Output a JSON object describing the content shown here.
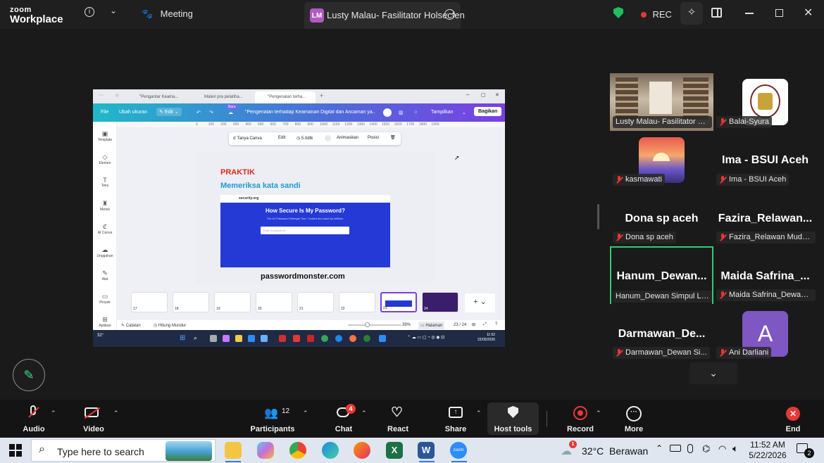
{
  "topbar": {
    "logo_line1": "zoom",
    "logo_line2": "Workplace",
    "meeting_label": "Meeting",
    "active_tab_avatar": "LM",
    "active_tab_title": "Lusty Malau- Fasilitator Holsecfen",
    "rec_label": "REC"
  },
  "shared_screen": {
    "browser_tabs": [
      "\"Pengantar Keama...",
      "Materi pra pelatiha...",
      "\"Pengenalan terha..."
    ],
    "canva": {
      "file": "File",
      "resize": "Ubah ukuran",
      "edit": "Edit",
      "new_badge": "Baru",
      "doc_title": "\"Pengenalan terhadap Keamanan Digital dan Ancaman ya...",
      "present": "Tampilkan",
      "share": "Bagikan",
      "sidebar": [
        "Template",
        "Elemen",
        "Teks",
        "Merek",
        "AI Canva",
        "Unggahan",
        "Alat",
        "Proyek",
        "Aplikasi"
      ],
      "floating_toolbar": [
        "Tanya Canva",
        "Edit",
        "5.0dtk",
        "Animasikan",
        "Posisi"
      ],
      "ruler_ticks": [
        "0",
        "100",
        "200",
        "300",
        "400",
        "500",
        "600",
        "700",
        "800",
        "900",
        "1000",
        "1100",
        "1200",
        "1300",
        "1400",
        "1500",
        "1600",
        "1700",
        "1800",
        "1900"
      ],
      "slide": {
        "kicker": "PRAKTIK",
        "title": "Memeriksa kata sandi",
        "site_brand": "security.org",
        "site_heading": "How Secure Is My Password?",
        "site_sub": "The #1 Password Strength Tool. Trusted and used by millions.",
        "site_placeholder": "Enter a password",
        "caption": "passwordmonster.com"
      },
      "thumb_numbers": [
        "17",
        "18",
        "19",
        "20",
        "21",
        "22",
        "23",
        "24"
      ],
      "notes": "Catatan",
      "timer": "Hitung Mundur",
      "zoom_pct": "39%",
      "page_label": "Halaman",
      "page_count": "23 / 24"
    },
    "win_time": "11:52",
    "win_date": "22/05/2026",
    "weather_temp": "32°"
  },
  "gallery": [
    {
      "name": "",
      "label": "Lusty Malau- Fasilitator H...",
      "muted": false,
      "kind": "photo-library"
    },
    {
      "name": "",
      "label": "Balai-Syura",
      "muted": true,
      "kind": "logo"
    },
    {
      "name": "",
      "label": "kasmawati",
      "muted": true,
      "kind": "sunset"
    },
    {
      "name": "Ima - BSUI Aceh",
      "label": "Ima - BSUI Aceh",
      "muted": true,
      "kind": "text"
    },
    {
      "name": "Dona sp aceh",
      "label": "Dona sp aceh",
      "muted": true,
      "kind": "text"
    },
    {
      "name": "Fazira_Relawan...",
      "label": "Fazira_Relawan Muda ...",
      "muted": true,
      "kind": "text"
    },
    {
      "name": "Hanum_Dewan...",
      "label": "Hanum_Dewan Simpul Lh...",
      "muted": false,
      "kind": "text",
      "active_speaker": true
    },
    {
      "name": "Maida Safrina_...",
      "label": "Maida Safrina_Dewan ...",
      "muted": true,
      "kind": "text"
    },
    {
      "name": "Darmawan_De...",
      "label": "Darmawan_Dewan Si...",
      "muted": true,
      "kind": "text"
    },
    {
      "name": "A",
      "label": "Ani Darliani",
      "muted": true,
      "kind": "avatar"
    }
  ],
  "toolbar": {
    "audio": "Audio",
    "video": "Video",
    "participants": "Participants",
    "participants_count": "12",
    "chat": "Chat",
    "chat_badge": "4",
    "react": "React",
    "share": "Share",
    "host_tools": "Host tools",
    "record": "Record",
    "more": "More",
    "end": "End"
  },
  "taskbar": {
    "search_placeholder": "Type here to search",
    "weather": "32°C  Berawan",
    "weather_badge": "1",
    "time": "11:52 AM",
    "date": "5/22/2026",
    "notif_count": "2"
  },
  "colors": {
    "active_speaker_border": "#2ecc71",
    "mute_red": "#e33333",
    "end_red": "#e53935",
    "canva_gradient_start": "#20b8c9",
    "canva_gradient_end": "#7b3fe4",
    "slide_blue": "#2539d6",
    "praktik_red": "#e0261b",
    "slide_title_teal": "#1d9bd1"
  }
}
